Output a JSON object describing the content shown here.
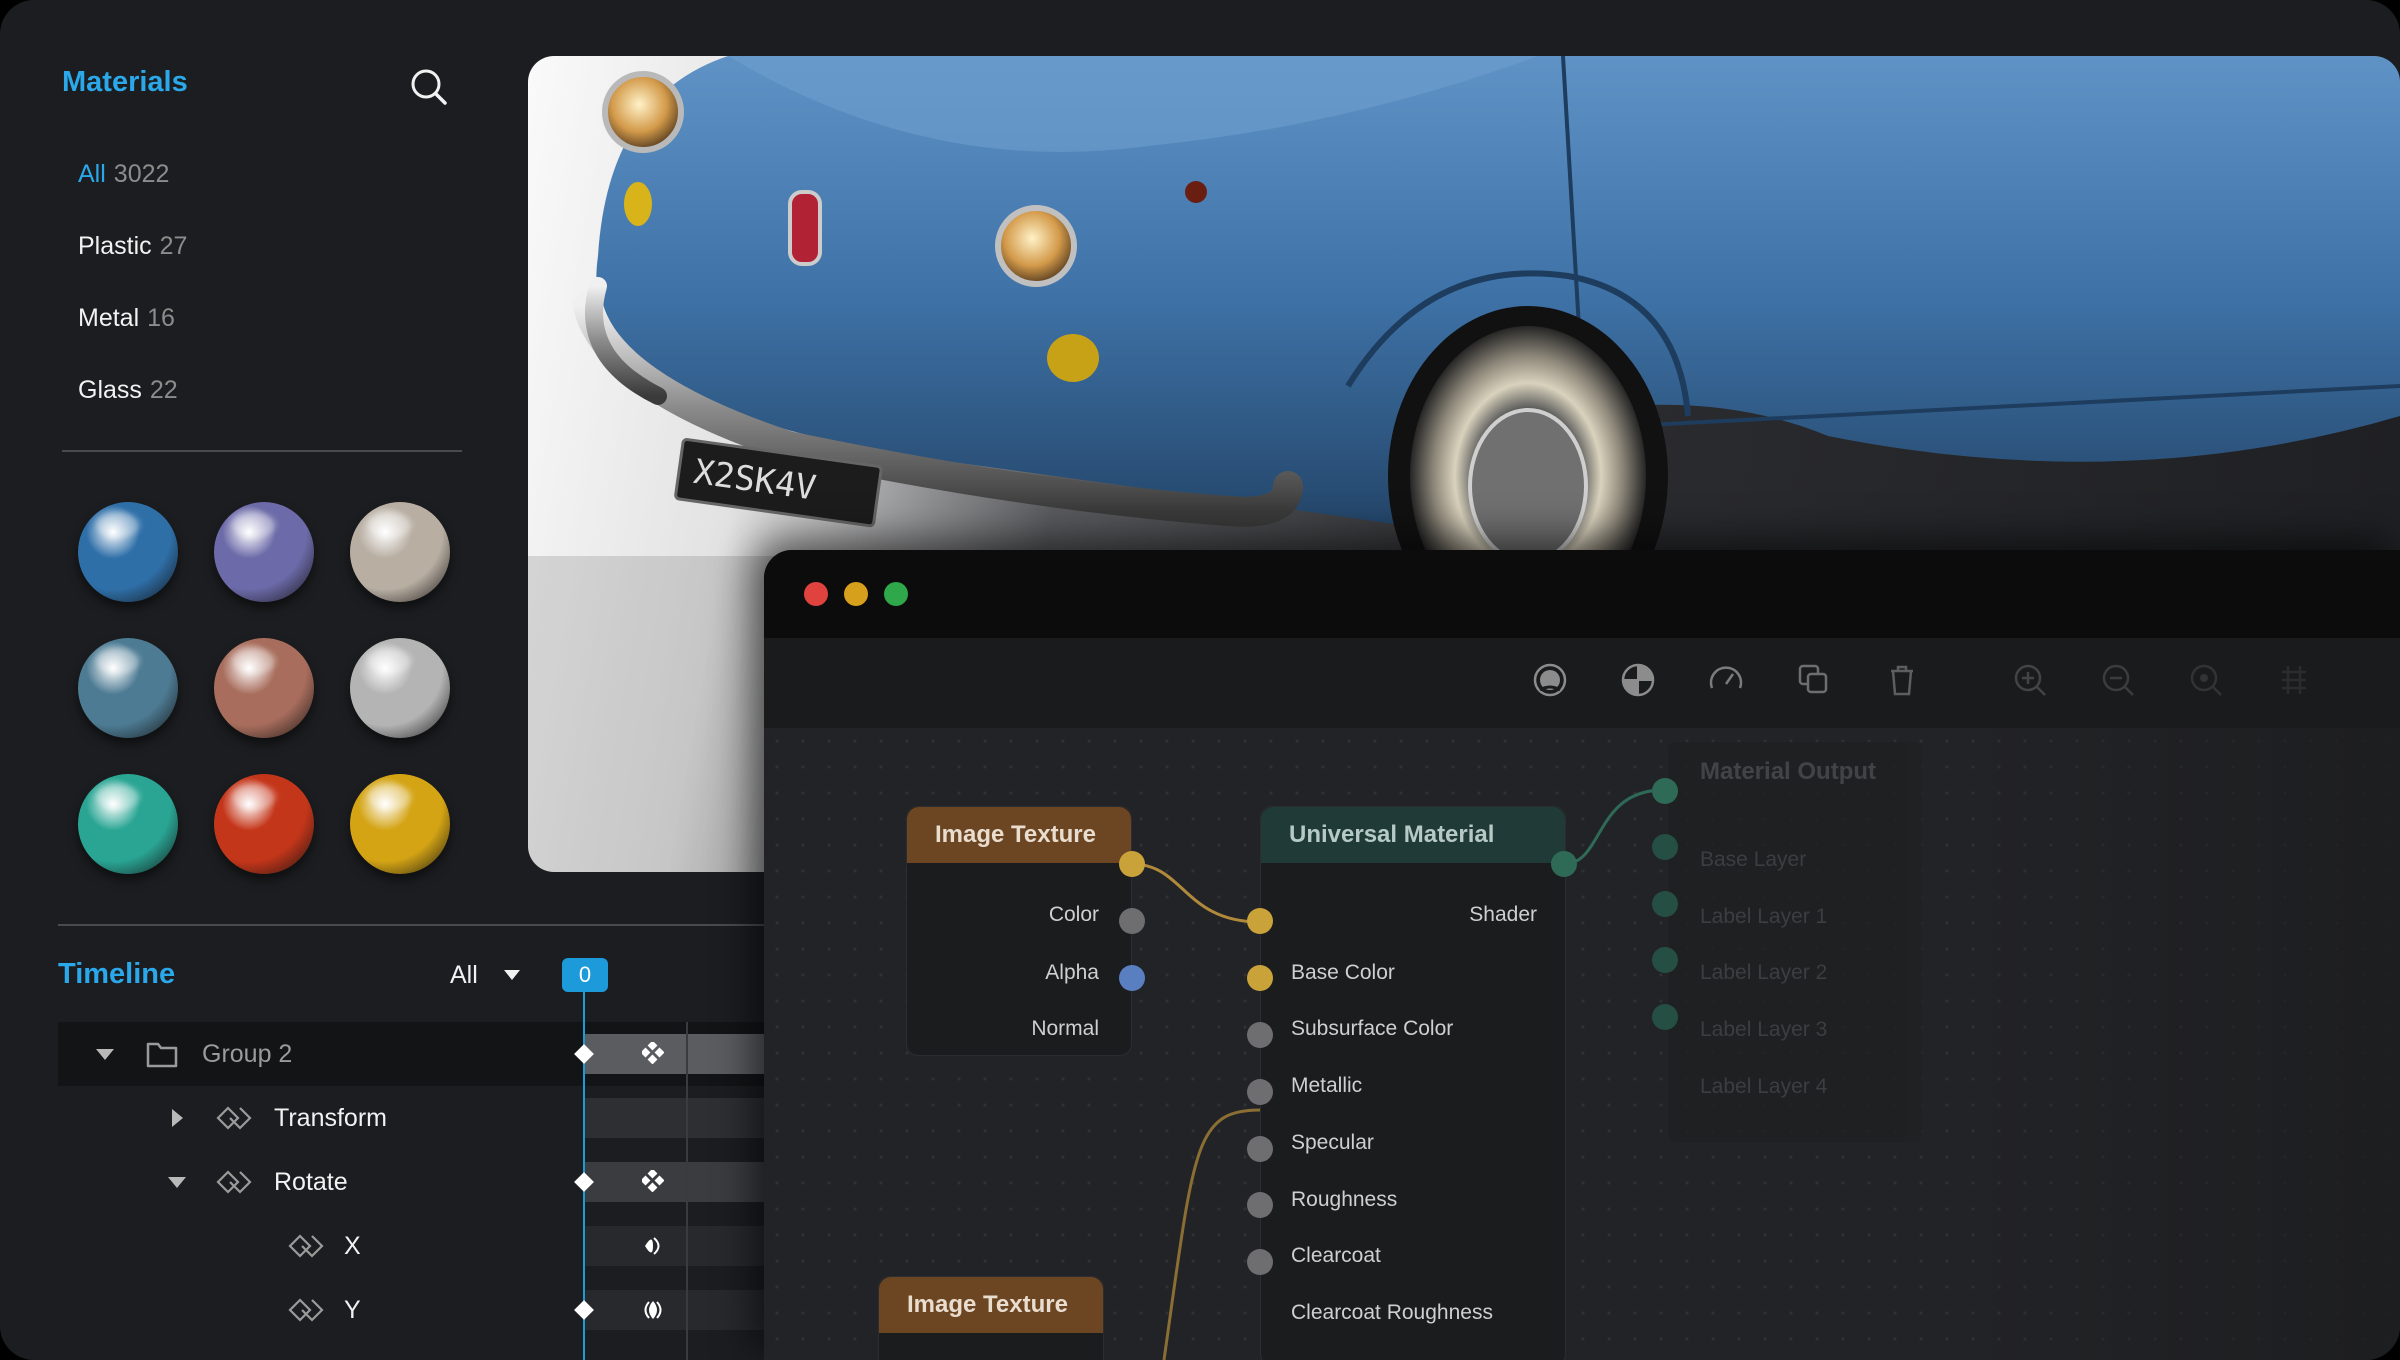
{
  "materials": {
    "title": "Materials",
    "search_icon": "search-icon",
    "categories": [
      {
        "name": "All",
        "count": "3022"
      },
      {
        "name": "Plastic",
        "count": "27"
      },
      {
        "name": "Metal",
        "count": "16"
      },
      {
        "name": "Glass",
        "count": "22"
      }
    ],
    "swatches": [
      {
        "name": "blue-metal",
        "color": "#2f6fa8"
      },
      {
        "name": "violet-metal",
        "color": "#6c6aa8"
      },
      {
        "name": "pearl",
        "color": "#b8aea2"
      },
      {
        "name": "steel-blue",
        "color": "#4d7b93"
      },
      {
        "name": "copper",
        "color": "#a86d5c"
      },
      {
        "name": "chrome",
        "color": "#b4b4b4"
      },
      {
        "name": "teal-glass",
        "color": "#2aa594"
      },
      {
        "name": "red-glass",
        "color": "#c4361a"
      },
      {
        "name": "gold-glass",
        "color": "#d4a415"
      }
    ]
  },
  "timeline": {
    "title": "Timeline",
    "filter": "All",
    "current_frame": "0",
    "rows": [
      {
        "label": "Group 2"
      },
      {
        "label": "Transform"
      },
      {
        "label": "Rotate"
      },
      {
        "label": "X"
      },
      {
        "label": "Y"
      }
    ]
  },
  "node_editor": {
    "toolbar_icons": [
      "material-icon",
      "globe-icon",
      "gauge-icon",
      "duplicate-icon",
      "trash-icon",
      "zoom-in-icon",
      "zoom-out-icon",
      "zoom-fit-icon",
      "grid-icon"
    ],
    "image_texture_1": {
      "title": "Image Texture",
      "outputs": [
        "Color",
        "Alpha",
        "Normal"
      ]
    },
    "universal_material": {
      "title": "Universal Material",
      "output": "Shader",
      "inputs": [
        "Base Color",
        "Subsurface Color",
        "Metallic",
        "Specular",
        "Roughness",
        "Clearcoat",
        "Clearcoat Roughness"
      ]
    },
    "material_output": {
      "title": "Material Output",
      "inputs": [
        "Base Layer",
        "Label Layer 1",
        "Label Layer 2",
        "Label Layer 3",
        "Label Layer 4"
      ]
    },
    "image_texture_2": {
      "title": "Image Texture"
    },
    "colors": {
      "yellow_socket": "#c9a23a",
      "grey_socket": "#6e6e70",
      "blue_socket": "#5a7fc0",
      "green_socket": "#2f6a57",
      "wire": "#b08a3a",
      "wire_green": "#2f6a57"
    }
  }
}
